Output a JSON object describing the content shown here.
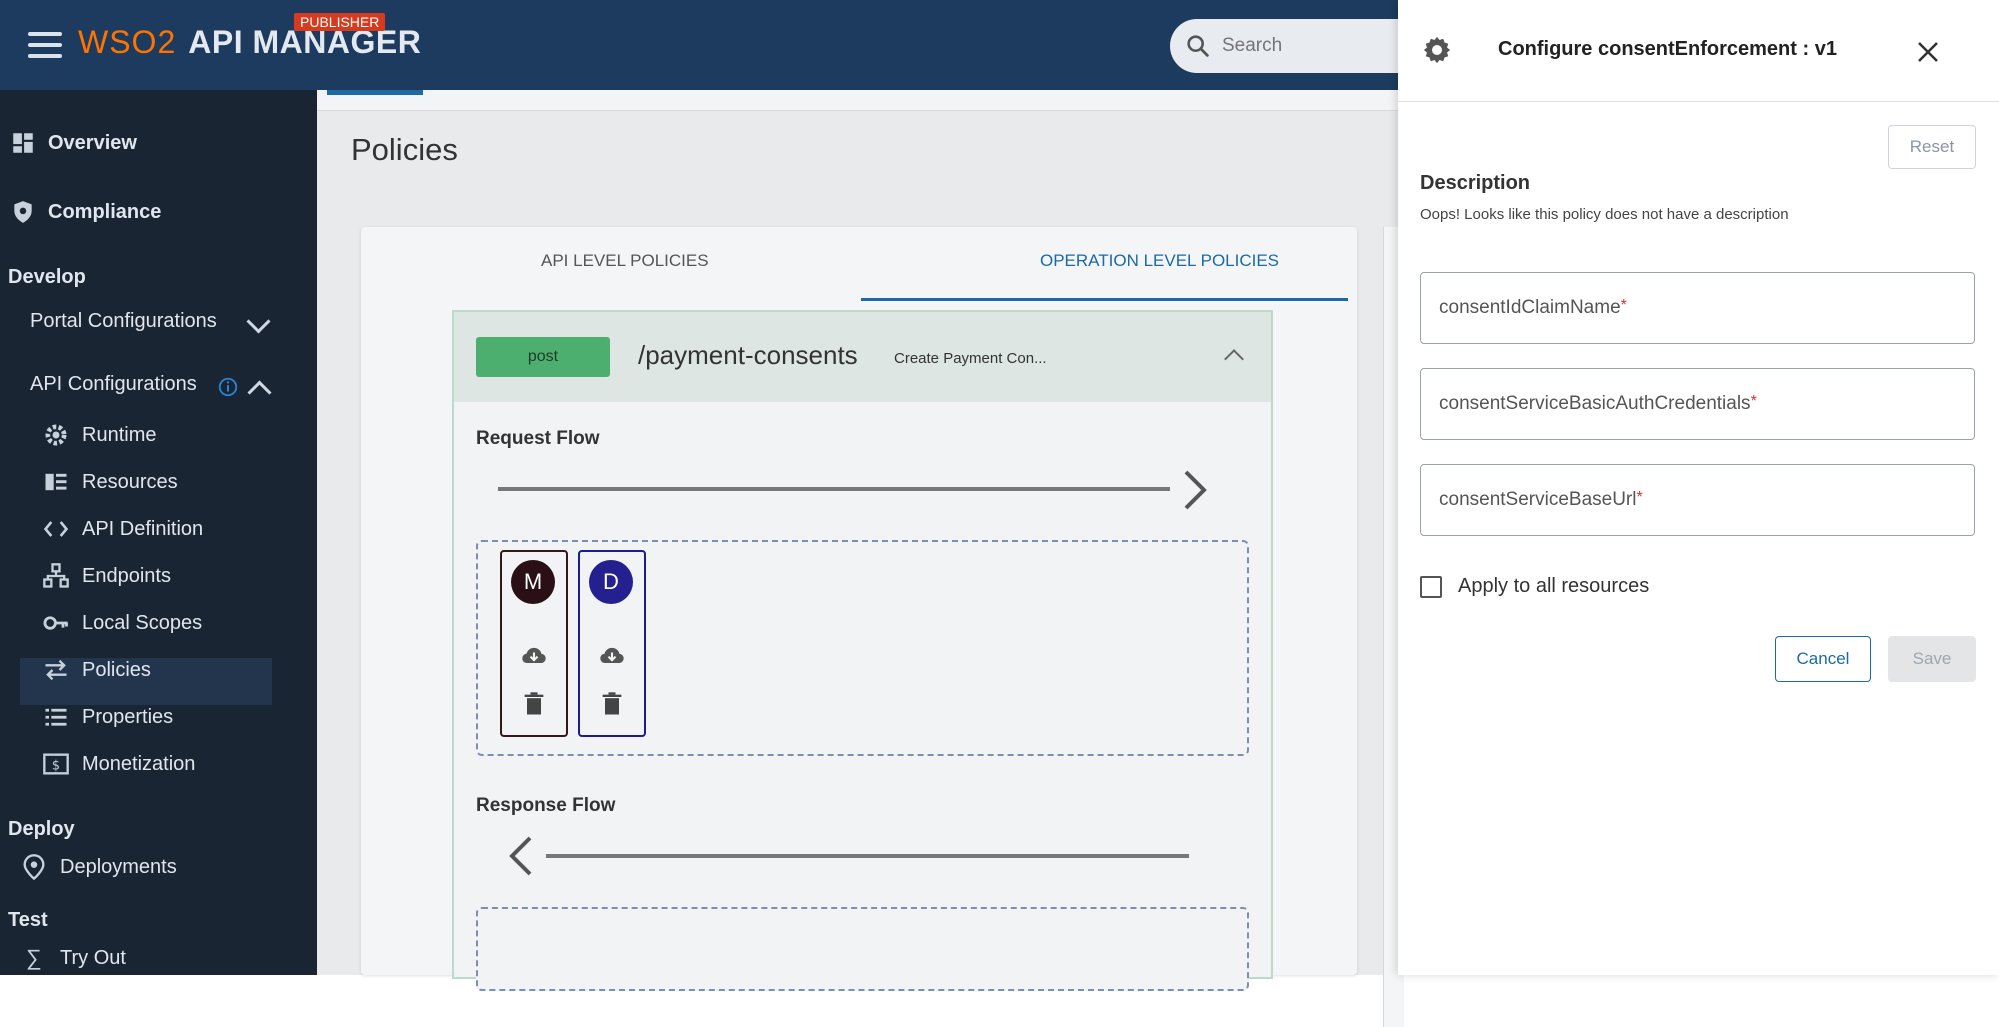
{
  "header": {
    "brand": "WSO2",
    "brand_sub": "2",
    "product": "API MANAGER",
    "badge": "PUBLISHER",
    "search_placeholder": "Search"
  },
  "sidebar": {
    "overview": "Overview",
    "compliance": "Compliance",
    "develop_heading": "Develop",
    "portal_configurations": "Portal Configurations",
    "api_configurations": "API Configurations",
    "items": [
      {
        "label": "Runtime",
        "icon": "gear-icon"
      },
      {
        "label": "Resources",
        "icon": "resources-icon"
      },
      {
        "label": "API Definition",
        "icon": "code-icon"
      },
      {
        "label": "Endpoints",
        "icon": "endpoints-icon"
      },
      {
        "label": "Local Scopes",
        "icon": "key-icon"
      },
      {
        "label": "Policies",
        "icon": "swap-icon"
      },
      {
        "label": "Properties",
        "icon": "list-icon"
      },
      {
        "label": "Monetization",
        "icon": "monetization-icon"
      }
    ],
    "active_item": "Policies",
    "deploy_heading": "Deploy",
    "deployments": "Deployments",
    "test_heading": "Test",
    "try_out": "Try Out"
  },
  "main": {
    "page_title": "Policies",
    "tabs": [
      {
        "label": "API LEVEL POLICIES",
        "active": false
      },
      {
        "label": "OPERATION LEVEL POLICIES",
        "active": true
      }
    ],
    "operation": {
      "method": "post",
      "path": "/payment-consents",
      "summary": "Create Payment Con..."
    },
    "request_flow_label": "Request Flow",
    "response_flow_label": "Response Flow",
    "policies": [
      {
        "letter": "M",
        "color": "#2a0f17"
      },
      {
        "letter": "D",
        "color": "#25208f"
      }
    ]
  },
  "drawer": {
    "title": "Configure consentEnforcement : v1",
    "reset_label": "Reset",
    "description_heading": "Description",
    "description_text": "Oops! Looks like this policy does not have a description",
    "fields": [
      {
        "label": "consentIdClaimName",
        "required": "*"
      },
      {
        "label": "consentServiceBasicAuthCredentials",
        "required": "*"
      },
      {
        "label": "consentServiceBaseUrl",
        "required": "*"
      }
    ],
    "apply_all_label": "Apply to all resources",
    "apply_all_checked": false,
    "cancel_label": "Cancel",
    "save_label": "Save"
  },
  "colors": {
    "appbar": "#1d3b5e",
    "sidebar": "#1a2533",
    "accent": "#1b6aa5",
    "post_badge": "#4caf6f",
    "required": "#d32f2f"
  }
}
